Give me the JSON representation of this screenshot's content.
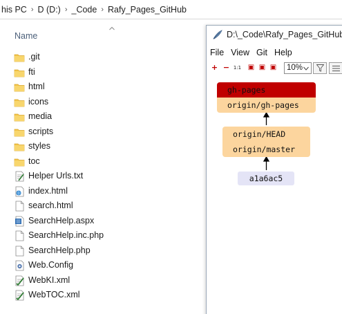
{
  "explorer": {
    "breadcrumb": [
      "his PC",
      "D (D:)",
      "_Code",
      "Rafy_Pages_GitHub"
    ],
    "column_name": "Name",
    "files": [
      {
        "name": ".git",
        "icon": "folder-icon"
      },
      {
        "name": "fti",
        "icon": "folder-icon"
      },
      {
        "name": "html",
        "icon": "folder-icon"
      },
      {
        "name": "icons",
        "icon": "folder-icon"
      },
      {
        "name": "media",
        "icon": "folder-icon"
      },
      {
        "name": "scripts",
        "icon": "folder-icon"
      },
      {
        "name": "styles",
        "icon": "folder-icon"
      },
      {
        "name": "toc",
        "icon": "folder-icon"
      },
      {
        "name": "Helper Urls.txt",
        "icon": "text-file-icon"
      },
      {
        "name": "index.html",
        "icon": "html-file-icon"
      },
      {
        "name": "search.html",
        "icon": "blank-file-icon"
      },
      {
        "name": "SearchHelp.aspx",
        "icon": "aspx-file-icon"
      },
      {
        "name": "SearchHelp.inc.php",
        "icon": "blank-file-icon"
      },
      {
        "name": "SearchHelp.php",
        "icon": "blank-file-icon"
      },
      {
        "name": "Web.Config",
        "icon": "config-file-icon"
      },
      {
        "name": "WebKI.xml",
        "icon": "xml-file-icon"
      },
      {
        "name": "WebTOC.xml",
        "icon": "xml-file-icon"
      }
    ]
  },
  "gitk": {
    "title": "D:\\_Code\\Rafy_Pages_GitHub -",
    "menu": [
      "File",
      "View",
      "Git",
      "Help"
    ],
    "toolbar_buttons": [
      "+",
      "−",
      "1:1",
      "▣",
      "▣",
      "▣",
      "▣"
    ],
    "zoom_value": "10%",
    "refs": {
      "local_branch": "gh-pages",
      "remote_branch": "origin/gh-pages",
      "remote_head": "origin/HEAD",
      "remote_master": "origin/master"
    },
    "commit_sha": "a1a6ac5"
  },
  "colors": {
    "local_branch": "#c00000",
    "remote_ref": "#fcd59e",
    "commit": "#e4e4f6",
    "folder": "#f3c54b"
  }
}
